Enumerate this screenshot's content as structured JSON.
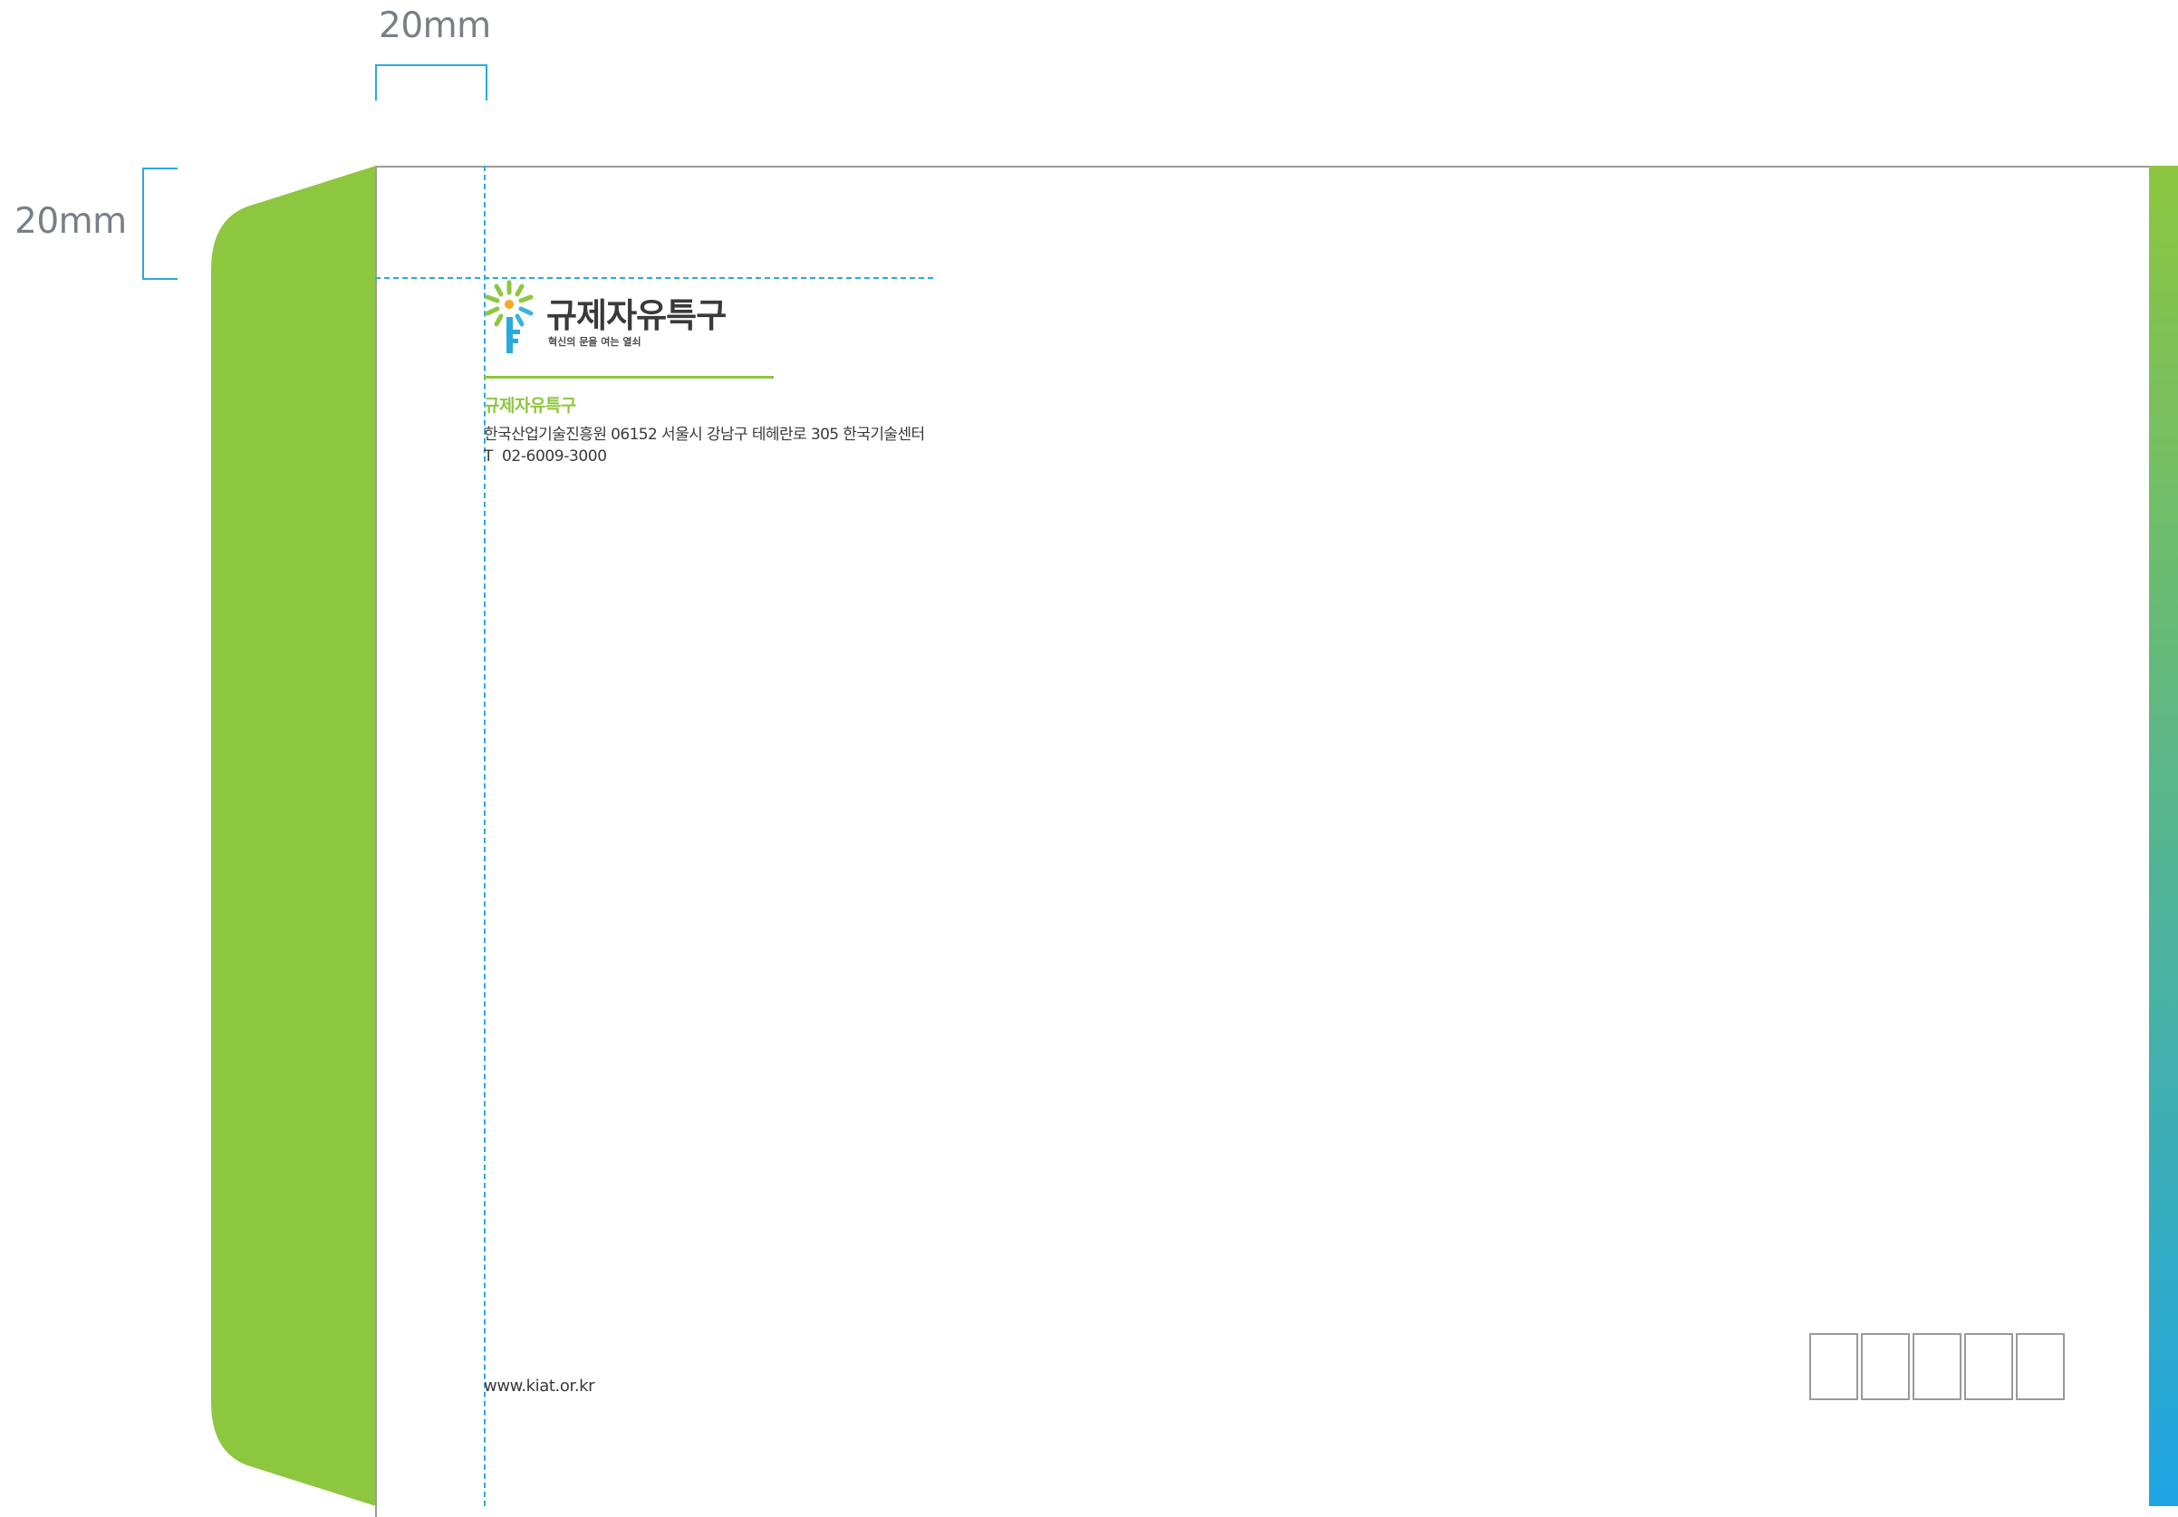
{
  "dimensions": {
    "top_margin_label": "20mm",
    "left_margin_label": "20mm"
  },
  "logo": {
    "icon": "key-sparkle-icon",
    "name": "규제자유특구",
    "tagline": "혁신의 문을 여는 열쇠"
  },
  "sender": {
    "name": "규제자유특구",
    "address": "한국산업기술진흥원 06152 서울시 강남구 테헤란로 305 한국기술센터",
    "phone": "T  02-6009-3000"
  },
  "footer": {
    "website": "www.kiat.or.kr"
  },
  "postal_code_boxes": 5,
  "colors": {
    "flap_green": "#8dc63f",
    "guide_blue": "#29a9e0",
    "accent_green": "#8dc63f",
    "text_dark": "#3a3a3a",
    "gradient_top": "#8dc63f",
    "gradient_bottom": "#1ea5e4"
  }
}
